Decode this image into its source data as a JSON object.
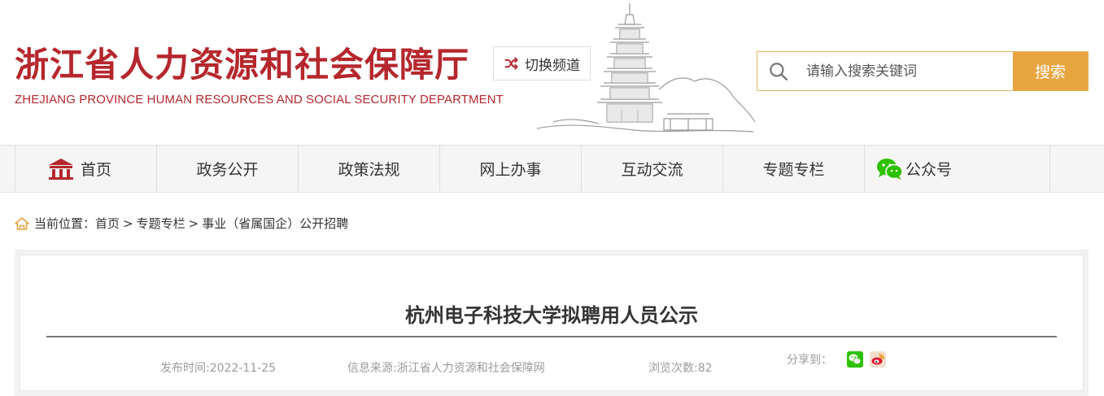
{
  "header": {
    "logo_cn": "浙江省人力资源和社会保障厅",
    "logo_en": "ZHEJIANG PROVINCE HUMAN RESOURCES AND SOCIAL SECURITY DEPARTMENT",
    "switch_label": "切换频道",
    "search": {
      "placeholder": "请输入搜索关键词",
      "button": "搜索"
    }
  },
  "nav": {
    "items": [
      {
        "label": "首页",
        "icon": "home-icon"
      },
      {
        "label": "政务公开"
      },
      {
        "label": "政策法规"
      },
      {
        "label": "网上办事"
      },
      {
        "label": "互动交流"
      },
      {
        "label": "专题专栏"
      },
      {
        "label": "公众号",
        "icon": "wechat-icon"
      }
    ]
  },
  "breadcrumb": {
    "prefix": "当前位置：",
    "items": [
      "首页",
      "专题专栏",
      "事业（省属国企）公开招聘"
    ],
    "separator": ">"
  },
  "article": {
    "title": "杭州电子科技大学拟聘用人员公示",
    "date": "发布时间:2022-11-25",
    "source": "信息来源:浙江省人力资源和社会保障网",
    "views": "浏览次数:82",
    "share_label": "分享到："
  },
  "colors": {
    "brand_red": "#b5272d",
    "search_orange": "#e8a43f",
    "wechat_green": "#2dc100"
  }
}
